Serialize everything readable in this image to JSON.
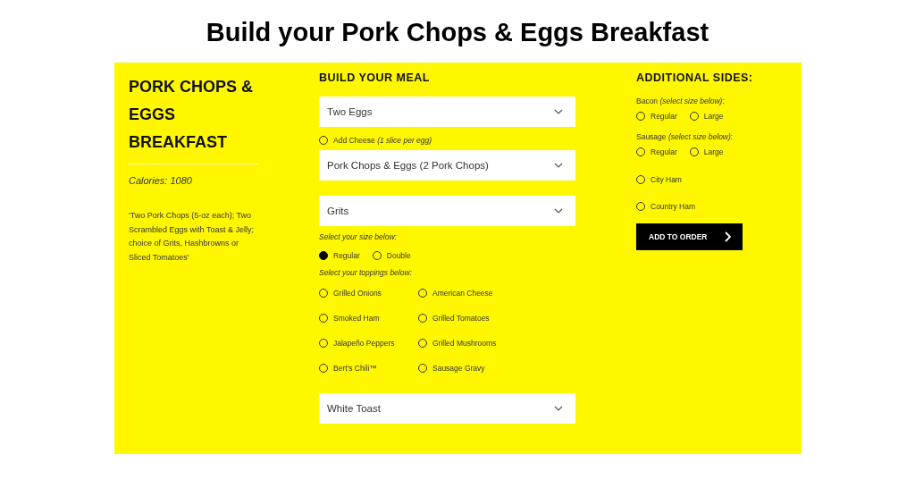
{
  "page_title": "Build your Pork Chops & Eggs Breakfast",
  "product": {
    "title": "PORK CHOPS & EGGS BREAKFAST",
    "calories": "Calories: 1080",
    "description": "'Two Pork Chops (5-oz each); Two Scrambled Eggs with Toast & Jelly; choice of Grits, Hashbrowns or Sliced Tomatoes'"
  },
  "meal": {
    "heading": "BUILD YOUR MEAL",
    "egg_select": {
      "value": "Two Eggs"
    },
    "cheese_option": {
      "label": "Add Cheese *(1 slice per egg)*",
      "checked": false
    },
    "main_select": {
      "value": "Pork Chops & Eggs (2 Pork Chops)"
    },
    "side_select": {
      "value": "Grits"
    },
    "size_prompt": "Select your size below:",
    "sizes": [
      {
        "label": "Regular",
        "selected": true
      },
      {
        "label": "Double",
        "selected": false
      }
    ],
    "toppings_prompt": "Select your toppings below:",
    "toppings": [
      {
        "label": "Grilled Onions",
        "checked": false
      },
      {
        "label": "American Cheese",
        "checked": false
      },
      {
        "label": "Smoked Ham",
        "checked": false
      },
      {
        "label": "Grilled Tomatoes",
        "checked": false
      },
      {
        "label": "Jalapeño Peppers",
        "checked": false
      },
      {
        "label": "Grilled Mushrooms",
        "checked": false
      },
      {
        "label": "Bert's Chili™",
        "checked": false
      },
      {
        "label": "Sausage Gravy",
        "checked": false
      }
    ],
    "toast_select": {
      "value": "White Toast"
    }
  },
  "sides": {
    "heading": "ADDITIONAL SIDES:",
    "groups": [
      {
        "label": "Bacon *(select size below)*:",
        "options": [
          {
            "label": "Regular",
            "selected": false
          },
          {
            "label": "Large",
            "selected": false
          }
        ]
      },
      {
        "label": "Sausage *(select size below)*:",
        "options": [
          {
            "label": "Regular",
            "selected": false
          },
          {
            "label": "Large",
            "selected": false
          }
        ]
      }
    ],
    "extras": [
      {
        "label": "City Ham",
        "checked": false
      },
      {
        "label": "Country Ham",
        "checked": false
      }
    ],
    "button": "ADD TO ORDER"
  }
}
